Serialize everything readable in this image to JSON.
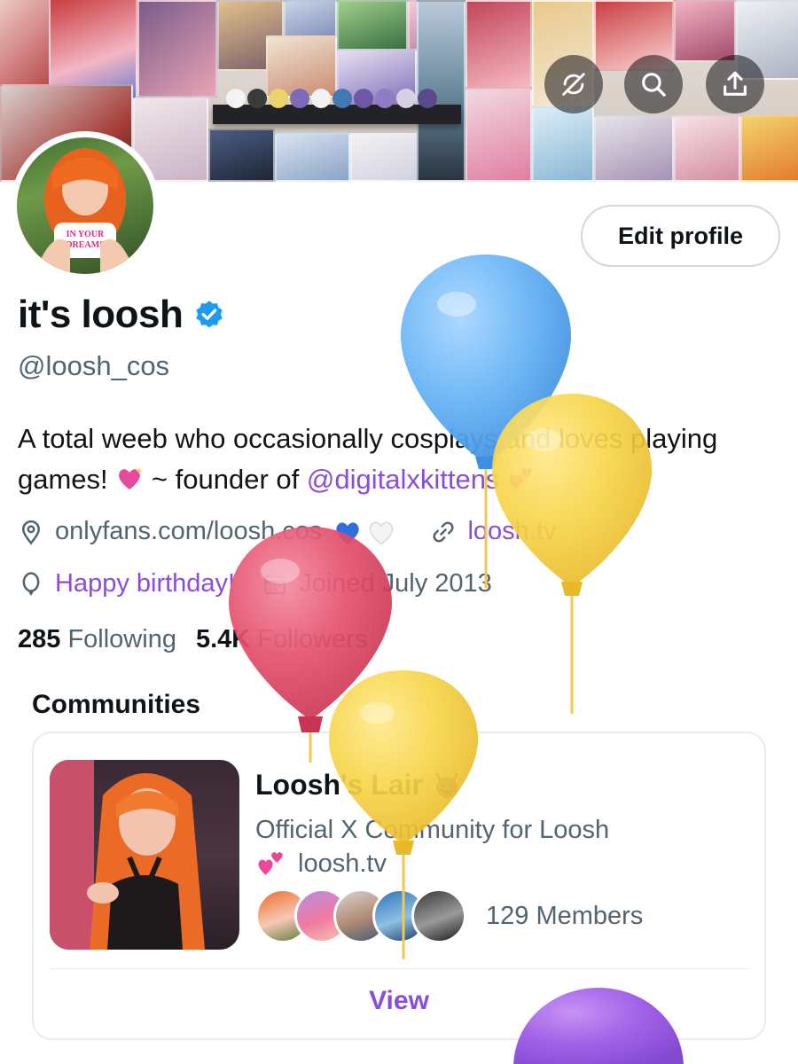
{
  "header": {
    "actions": [
      {
        "icon": "no-sync-icon"
      },
      {
        "icon": "search-icon"
      },
      {
        "icon": "share-icon"
      }
    ]
  },
  "profile": {
    "edit_label": "Edit profile",
    "display_name": "it's loosh",
    "handle": "@loosh_cos",
    "bio_part1": "A total weeb who occasionally cosplays and loves playing games!",
    "bio_part2": "~ founder of",
    "bio_mention": "@digitalxkittens",
    "website_text": "onlyfans.com/loosh.cos",
    "link_text": "loosh.tv",
    "birthday_text": "Happy birthday!",
    "joined_text": "Joined July 2013",
    "following_count": "285",
    "following_label": "Following",
    "followers_count": "5.4K",
    "followers_label": "Followers"
  },
  "communities": {
    "title": "Communities",
    "card": {
      "name": "Loosh's Lair",
      "description": "Official X Community for Loosh",
      "description_line2": "loosh.tv",
      "members_text": "129 Members",
      "view_label": "View"
    }
  },
  "colors": {
    "accent": "#8a4ddb",
    "verified": "#1d9bf0",
    "text_primary": "#0f1419",
    "text_secondary": "#536471"
  }
}
